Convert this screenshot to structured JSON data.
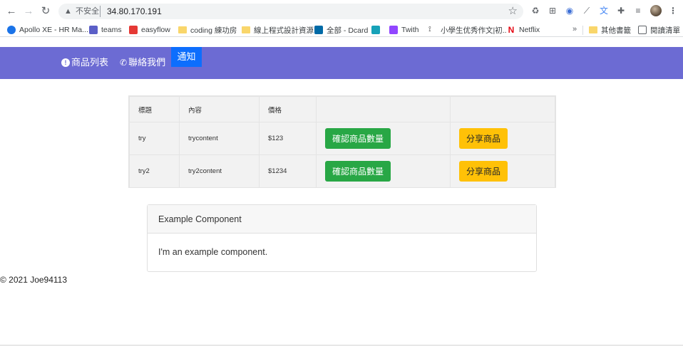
{
  "browser": {
    "security_label": "不安全",
    "url": "34.80.170.191",
    "bookmarks": [
      {
        "label": "Apollo XE - HR Ma...",
        "color": "#1a73e8"
      },
      {
        "label": "teams",
        "color": "#5b5fc7"
      },
      {
        "label": "easyflow",
        "color": "#e53935"
      },
      {
        "label": "coding 練功房",
        "color": "#f9d66b"
      },
      {
        "label": "線上程式設計資源",
        "color": "#f9d66b"
      },
      {
        "label": "全部 - Dcard",
        "color": "#006aa6"
      },
      {
        "label": "",
        "color": "#17a2b8"
      },
      {
        "label": "Twith",
        "color": "#9146ff"
      },
      {
        "label": "小學生优秀作文|初...",
        "color": "#333333"
      },
      {
        "label": "Netflix",
        "color": "#e50914"
      }
    ],
    "more_bookmarks": "»",
    "other_bookmarks": "其他書籤",
    "reading_list": "閱讀清單"
  },
  "navbar": {
    "color": "#6c6bd3",
    "product_list": "商品列表",
    "contact_us": "聯絡我們",
    "notify": "通知"
  },
  "table": {
    "headers": [
      "標題",
      "內容",
      "價格",
      "",
      ""
    ],
    "rows": [
      {
        "title": "try",
        "content": "trycontent",
        "price": "$123",
        "confirm": "確認商品數量",
        "share": "分享商品"
      },
      {
        "title": "try2",
        "content": "try2content",
        "price": "$1234",
        "confirm": "確認商品數量",
        "share": "分享商品"
      }
    ]
  },
  "card": {
    "header": "Example Component",
    "body": "I'm an example component."
  },
  "footer": {
    "text": "© 2021 Joe94113"
  }
}
